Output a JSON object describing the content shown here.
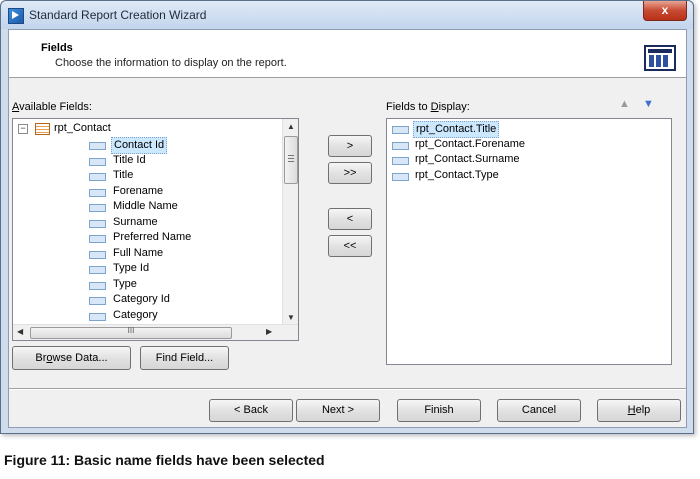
{
  "window": {
    "title": "Standard Report Creation Wizard",
    "close_glyph": "x"
  },
  "header": {
    "title": "Fields",
    "subtitle": "Choose the information to display on the report.",
    "icon": "table-view-icon"
  },
  "available": {
    "label_prefix": "",
    "label_access": "A",
    "label_rest": "vailable Fields:",
    "table": "rpt_Contact",
    "items": [
      "Contact Id",
      "Title Id",
      "Title",
      "Forename",
      "Middle Name",
      "Surname",
      "Preferred Name",
      "Full Name",
      "Type Id",
      "Type",
      "Category Id",
      "Category"
    ],
    "hscroll_thumb_glyph": "III"
  },
  "display": {
    "label_prefix": "Fields to ",
    "label_access": "D",
    "label_rest": "isplay:",
    "items": [
      "rpt_Contact.Title",
      "rpt_Contact.Forename",
      "rpt_Contact.Surname",
      "rpt_Contact.Type"
    ],
    "up_icon": "move-up-icon",
    "down_icon": "move-down-icon"
  },
  "move_buttons": {
    "add": ">",
    "add_all": ">>",
    "remove": "<",
    "remove_all": "<<"
  },
  "lower_buttons": {
    "browse_pre": "Br",
    "browse_access": "o",
    "browse_post": "wse Data...",
    "find": "Find Field..."
  },
  "footer": {
    "back": "< Back",
    "next": "Next >",
    "finish": "Finish",
    "cancel": "Cancel",
    "help_access": "H",
    "help_rest": "elp"
  },
  "caption": "Figure 11: Basic name fields have been selected"
}
